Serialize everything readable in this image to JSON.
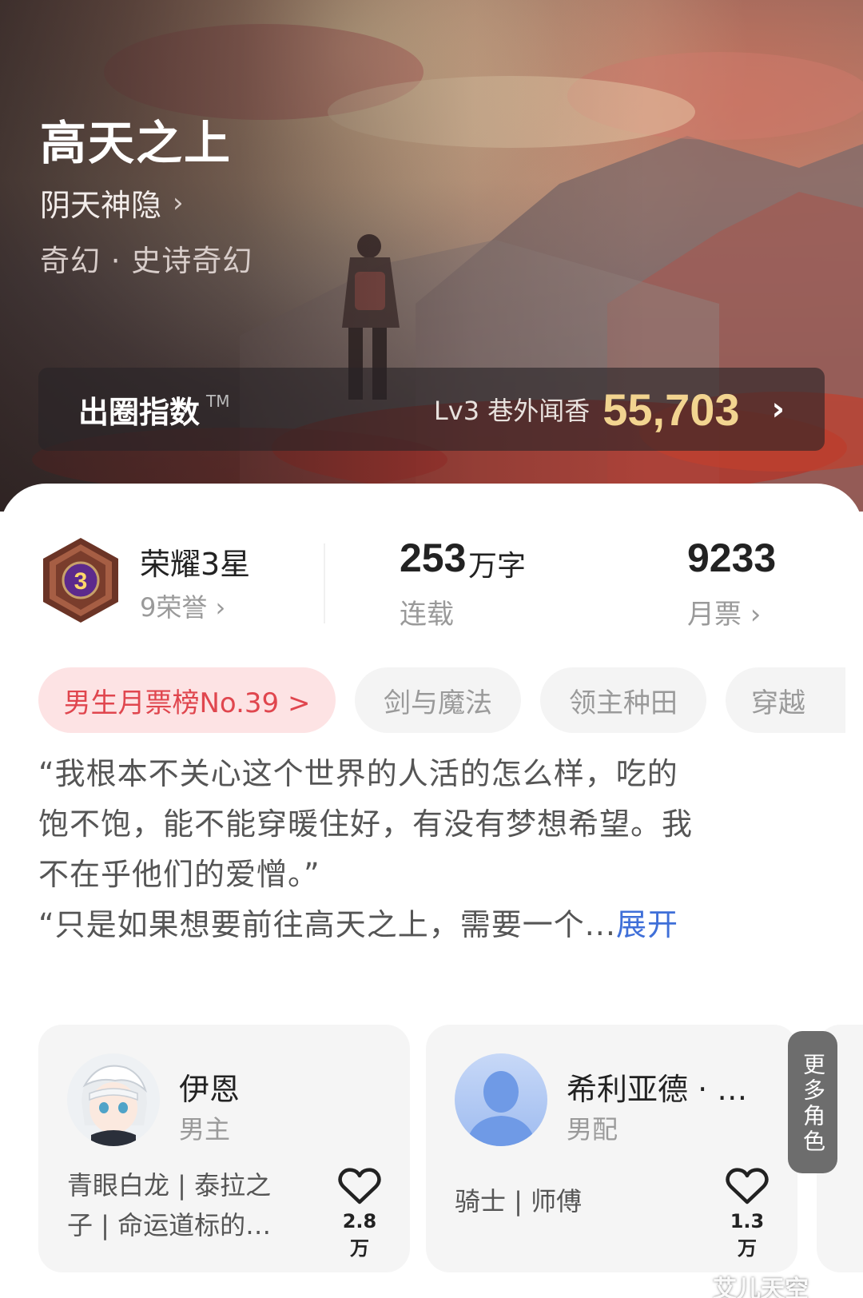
{
  "hero": {
    "title": "高天之上",
    "author": "阴天神隐",
    "author_chevron": "›",
    "genre": "奇幻 · 史诗奇幻"
  },
  "index_bar": {
    "label": "出圈指数",
    "trademark": "TM",
    "level": "Lv3 巷外闻香",
    "value": "55,703",
    "chevron": "›"
  },
  "stats": {
    "honor_badge_number": "3",
    "honor_title": "荣耀3星",
    "honor_sub": "9荣誉 ›",
    "words_number": "253",
    "words_unit": "万字",
    "words_label": "连载",
    "monthly_votes": "9233",
    "monthly_label": "月票 ›"
  },
  "tags": [
    "男生月票榜No.39 >",
    "剑与魔法",
    "领主种田",
    "穿越"
  ],
  "synopsis": {
    "lines": [
      "“我根本不关心这个世界的人活的怎么样，吃的",
      "饱不饱，能不能穿暖住好，有没有梦想希望。我",
      "不在乎他们的爱憎。”",
      "“只是如果想要前往高天之上，需要一个..."
    ],
    "expand": "展开"
  },
  "characters": [
    {
      "name": "伊恩",
      "role": "男主",
      "desc_lines": [
        "青眼白龙 | 泰拉之",
        "子 | 命运道标的…"
      ],
      "likes": "2.8万",
      "avatar_icon": "anime-avatar-icon"
    },
    {
      "name": "希利亚德 · …",
      "role": "男配",
      "desc_lines": [
        "骑士 | 师傅"
      ],
      "likes": "1.3万",
      "avatar_icon": "default-avatar-icon"
    }
  ],
  "more_roles": "更多角色",
  "watermark": "艾儿天空",
  "colors": {
    "rank_tag_text": "#e0464e",
    "rank_tag_bg": "#fde3e4",
    "index_value": "#f2d490",
    "expand_link": "#3f6fd8",
    "badge_purple": "#6a2d9e",
    "badge_bronze": "#8a4a36"
  }
}
